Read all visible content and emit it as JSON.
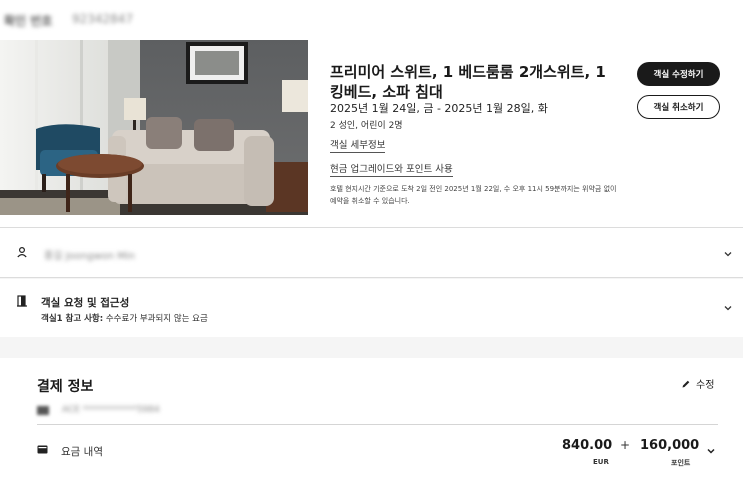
{
  "confirmation": {
    "label": "확인 번호",
    "number": "92342847"
  },
  "room": {
    "title": "프리미어 스위트, 1 베드룸룸 2개스위트, 1 킹베드, 소파 침대",
    "dates": "2025년 1월 24일, 금 - 2025년 1월 28일, 화",
    "guests": "2 성인, 어린이 2명",
    "details_link": "객실 세부정보",
    "upgrade_link": "현금 업그레이드와 포인트 사용",
    "policy": "호텔 현지시간 기준으로 도착 2일 전인 2025년 1월 22일, 수 오후 11시 59분까지는 위약금 없이 예약을 취소할 수 있습니다.",
    "modify_button": "객실 수정하기",
    "cancel_button": "객실 취소하기"
  },
  "guest": {
    "name": "홍길 Joongwon Min"
  },
  "requests": {
    "title": "객실 요청 및 접근성",
    "note_label": "객실1 참고 사항:",
    "note_value": " 수수료가 부과되지 않는 요금"
  },
  "payment": {
    "title": "결제 정보",
    "edit_label": "수정",
    "card_masked": "ACE ************5984",
    "charges_label": "요금 내역",
    "cash_amount": "840.00",
    "cash_unit": "EUR",
    "plus": "+",
    "points_amount": "160,000",
    "points_unit": "포인트"
  },
  "icons": {
    "guest": "person-icon",
    "request": "door-icon",
    "edit": "pencil-icon",
    "card": "credit-card-icon",
    "charges": "wallet-icon",
    "expand": "chevron-down-icon"
  },
  "colors": {
    "primary_button": "#1a1a1a",
    "page_background": "#f5f5f5",
    "card_background": "#ffffff"
  }
}
